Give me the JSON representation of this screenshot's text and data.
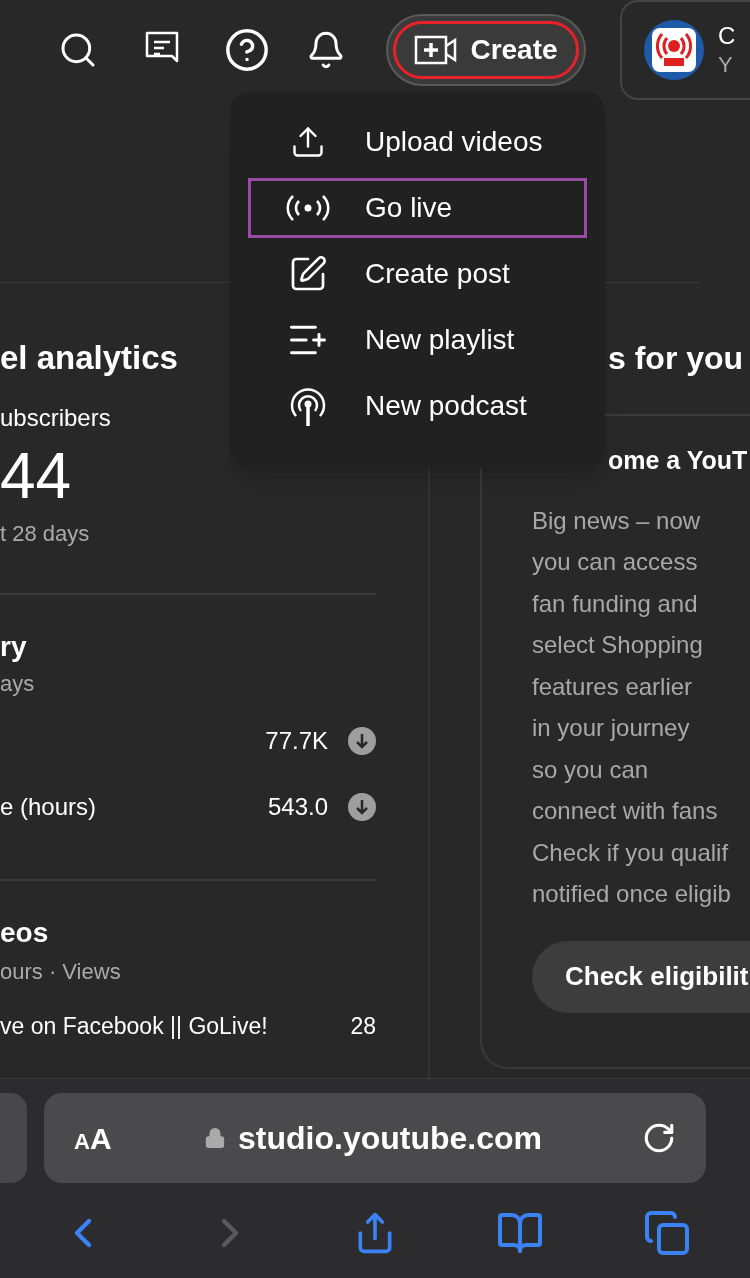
{
  "header": {
    "create_button": {
      "label": "Create",
      "annotated": true
    },
    "channel": {
      "name": "C",
      "subtitle": "Y"
    }
  },
  "create_menu": [
    {
      "kind": "upload",
      "label": "Upload videos",
      "annotated": false
    },
    {
      "kind": "live",
      "label": "Go live",
      "annotated": true
    },
    {
      "kind": "post",
      "label": "Create post",
      "annotated": false
    },
    {
      "kind": "playlist",
      "label": "New playlist",
      "annotated": false
    },
    {
      "kind": "podcast",
      "label": "New podcast",
      "annotated": false
    }
  ],
  "analytics": {
    "title": "el analytics",
    "subscribers_label": "ubscribers",
    "subscribers_value": "44",
    "period": "t 28 days",
    "summary": {
      "title": "ry",
      "period": "ays",
      "rows": [
        {
          "label": "",
          "value": "77.7K"
        },
        {
          "label": "e (hours)",
          "value": "543.0"
        }
      ]
    },
    "top_videos": {
      "title": "eos",
      "columns": "ours · Views",
      "rows": [
        {
          "title": "ve on Facebook || GoLive!",
          "value": "28"
        }
      ]
    }
  },
  "ideas": {
    "title": "s for you",
    "card": {
      "heading": "ome a YouT",
      "body": [
        "Big news – now",
        "you can access",
        "fan funding and",
        "select Shopping",
        "features earlier",
        "in your journey",
        "so you can",
        "connect with fans",
        "Check if you qualif",
        "notified once eligib"
      ],
      "button": "Check eligibilit"
    }
  },
  "browser": {
    "text_size_button": "AA",
    "url": "studio.youtube.com",
    "back_enabled": true,
    "forward_enabled": false
  }
}
